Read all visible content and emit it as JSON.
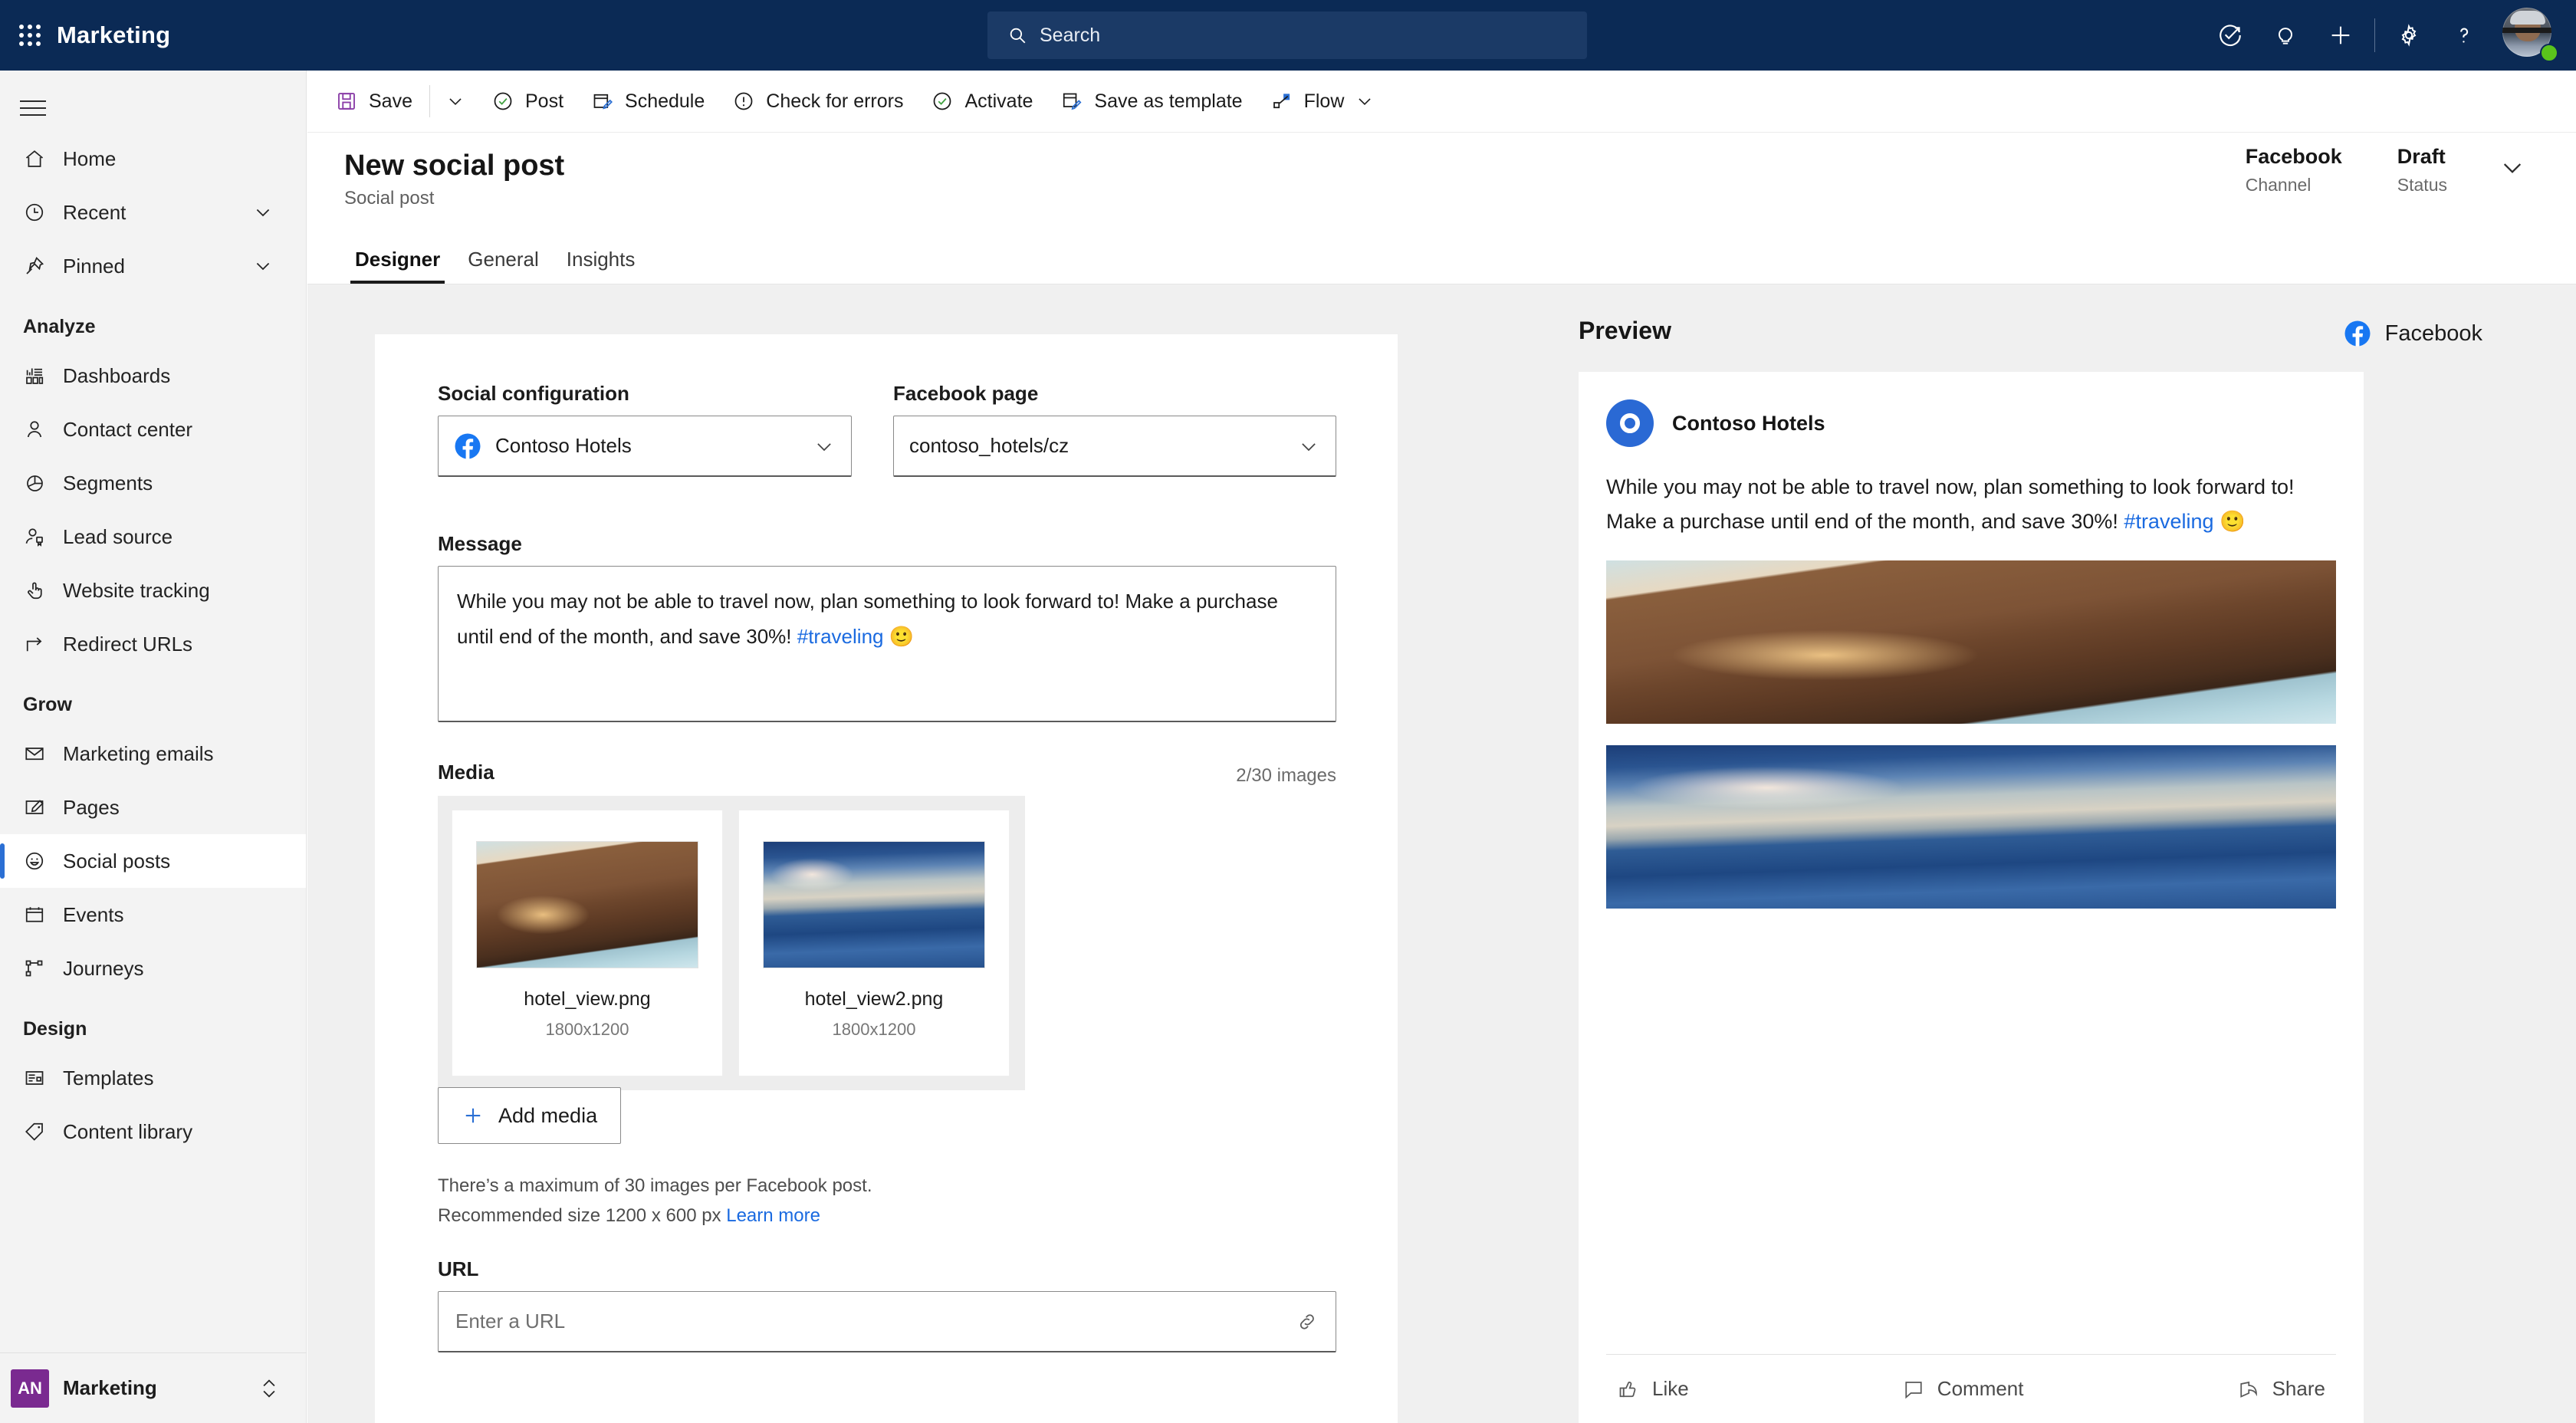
{
  "topbar": {
    "app_name": "Marketing",
    "waffle_icon": "app-launcher-icon",
    "search": {
      "placeholder": "Search",
      "icon": "search-icon"
    },
    "icons": [
      {
        "name": "trial-check-arrow-icon"
      },
      {
        "name": "lightbulb-icon"
      },
      {
        "name": "plus-icon"
      },
      {
        "name": "gear-icon"
      },
      {
        "name": "question-mark-icon"
      }
    ],
    "avatar": {
      "name": "user-avatar",
      "presence": "available",
      "presence_color": "#5ac41c"
    },
    "background": "#0b2a55"
  },
  "sidebar": {
    "hamburger_icon": "hamburger-menu-icon",
    "top_items": [
      {
        "label": "Home",
        "icon": "home-icon",
        "expandable": false
      },
      {
        "label": "Recent",
        "icon": "clock-icon",
        "expandable": true
      },
      {
        "label": "Pinned",
        "icon": "pin-icon",
        "expandable": true
      }
    ],
    "groups": [
      {
        "title": "Analyze",
        "items": [
          {
            "label": "Dashboards",
            "icon": "dashboard-icon"
          },
          {
            "label": "Contact center",
            "icon": "person-icon"
          },
          {
            "label": "Segments",
            "icon": "pie-chart-icon"
          },
          {
            "label": "Lead source",
            "icon": "person-badge-icon"
          },
          {
            "label": "Website tracking",
            "icon": "pointer-hand-icon"
          },
          {
            "label": "Redirect URLs",
            "icon": "arrow-redirect-icon"
          }
        ]
      },
      {
        "title": "Grow",
        "items": [
          {
            "label": "Marketing emails",
            "icon": "envelope-icon"
          },
          {
            "label": "Pages",
            "icon": "page-edit-icon"
          },
          {
            "label": "Social posts",
            "icon": "smiley-icon",
            "selected": true
          },
          {
            "label": "Events",
            "icon": "calendar-icon"
          },
          {
            "label": "Journeys",
            "icon": "journey-flow-icon"
          }
        ]
      },
      {
        "title": "Design",
        "items": [
          {
            "label": "Templates",
            "icon": "template-icon"
          },
          {
            "label": "Content library",
            "icon": "tag-icon"
          }
        ]
      }
    ],
    "org_switcher": {
      "initials": "AN",
      "label": "Marketing",
      "chevron_icon": "chevron-updown-icon",
      "badge_color": "#7a2a90"
    }
  },
  "command_bar": {
    "items": [
      {
        "label": "Save",
        "icon": "save-disk-icon"
      },
      {
        "label": "",
        "icon": "chevron-down-icon",
        "caret_only": true
      },
      {
        "label": "Post",
        "icon": "check-circle-icon"
      },
      {
        "label": "Schedule",
        "icon": "calendar-edit-icon"
      },
      {
        "label": "Check for errors",
        "icon": "exclamation-circle-icon"
      },
      {
        "label": "Activate",
        "icon": "check-circle-green-icon"
      },
      {
        "label": "Save as template",
        "icon": "save-template-icon"
      },
      {
        "label": "Flow",
        "icon": "flow-icon",
        "has_caret": true
      }
    ]
  },
  "page_header": {
    "title": "New social post",
    "subtitle": "Social post",
    "meta": [
      {
        "value": "Facebook",
        "key": "Channel"
      },
      {
        "value": "Draft",
        "key": "Status"
      }
    ],
    "expand_icon": "chevron-down-icon"
  },
  "tabs": [
    {
      "label": "Designer",
      "active": true
    },
    {
      "label": "General",
      "active": false
    },
    {
      "label": "Insights",
      "active": false
    }
  ],
  "form": {
    "social_configuration": {
      "label": "Social configuration",
      "value": "Contoso Hotels",
      "icon": "facebook-icon",
      "chevron_icon": "chevron-down-icon"
    },
    "facebook_page": {
      "label": "Facebook page",
      "value": "contoso_hotels/cz",
      "chevron_icon": "chevron-down-icon"
    },
    "message": {
      "label": "Message",
      "text_before": "While you may not be able to travel now, plan something to look forward to! Make a purchase until end of the month, and save 30%! ",
      "hashtag": "#traveling",
      "emoji": "🙂"
    },
    "media": {
      "label": "Media",
      "count_text": "2/30 images",
      "items": [
        {
          "name": "hotel_view.png",
          "size": "1800x1200"
        },
        {
          "name": "hotel_view2.png",
          "size": "1800x1200"
        }
      ],
      "add_button": {
        "label": "Add media",
        "icon": "plus-icon"
      },
      "help_line1": "There’s a maximum of 30 images per Facebook post.",
      "help_line2": "Recommended size 1200 x 600 px ",
      "help_link": "Learn more"
    },
    "url": {
      "label": "URL",
      "placeholder": "Enter a URL",
      "icon": "link-icon"
    }
  },
  "preview": {
    "title": "Preview",
    "channel_label": "Facebook",
    "channel_icon": "facebook-icon",
    "post": {
      "author": "Contoso Hotels",
      "avatar_icon": "contoso-avatar-icon",
      "text_before": "While you may not be able to travel now, plan something to look forward to! Make a purchase until end of the month, and save 30%! ",
      "hashtag": "#traveling",
      "emoji": "🙂",
      "actions": [
        {
          "label": "Like",
          "icon": "thumbs-up-icon"
        },
        {
          "label": "Comment",
          "icon": "comment-bubble-icon"
        },
        {
          "label": "Share",
          "icon": "share-arrow-icon"
        }
      ]
    }
  },
  "colors": {
    "brand_navy": "#0b2a55",
    "accent_blue": "#1a6ae0",
    "facebook_blue": "#1877f2",
    "selected_indicator": "#2b6fd4",
    "canvas": "#f0f0f0"
  }
}
